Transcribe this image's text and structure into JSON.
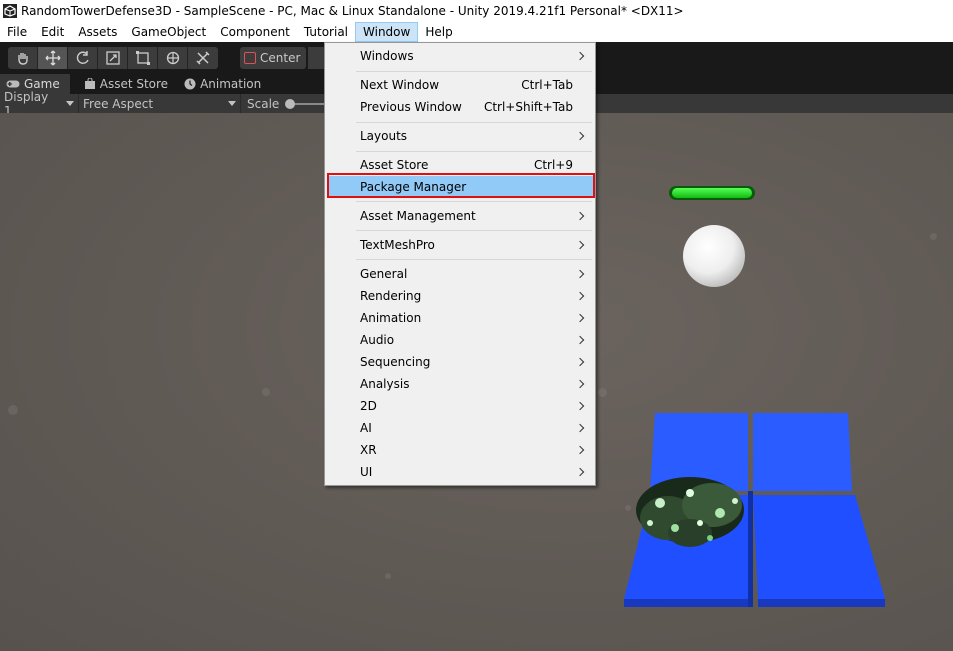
{
  "title": "RandomTowerDefense3D - SampleScene - PC, Mac & Linux Standalone - Unity 2019.4.21f1 Personal* <DX11>",
  "menubar": [
    "File",
    "Edit",
    "Assets",
    "GameObject",
    "Component",
    "Tutorial",
    "Window",
    "Help"
  ],
  "active_menu": "Window",
  "toolbar": {
    "pivot_label": "Center"
  },
  "tabs": [
    {
      "label": "Game",
      "icon": "game-controller-icon"
    },
    {
      "label": "Asset Store",
      "icon": "shopping-bag-icon"
    },
    {
      "label": "Animation",
      "icon": "clock-icon"
    }
  ],
  "game_controls": {
    "display": "Display 1",
    "aspect": "Free Aspect",
    "scale_label": "Scale"
  },
  "window_menu": {
    "items": [
      {
        "label": "Windows",
        "submenu": true
      },
      {
        "label": "Next Window",
        "shortcut": "Ctrl+Tab"
      },
      {
        "label": "Previous Window",
        "shortcut": "Ctrl+Shift+Tab"
      },
      {
        "label": "Layouts",
        "submenu": true
      },
      {
        "label": "Asset Store",
        "shortcut": "Ctrl+9"
      },
      {
        "label": "Package Manager",
        "highlighted": true
      },
      {
        "label": "Asset Management",
        "submenu": true
      },
      {
        "label": "TextMeshPro",
        "submenu": true
      },
      {
        "label": "General",
        "submenu": true
      },
      {
        "label": "Rendering",
        "submenu": true
      },
      {
        "label": "Animation",
        "submenu": true
      },
      {
        "label": "Audio",
        "submenu": true
      },
      {
        "label": "Sequencing",
        "submenu": true
      },
      {
        "label": "Analysis",
        "submenu": true
      },
      {
        "label": "2D",
        "submenu": true
      },
      {
        "label": "AI",
        "submenu": true
      },
      {
        "label": "XR",
        "submenu": true
      },
      {
        "label": "UI",
        "submenu": true
      }
    ]
  },
  "colors": {
    "highlight": "#91c9f7",
    "annotation_box": "#e01010",
    "health_bar": "#22dd22",
    "tile_blue": "#1f4fff"
  }
}
